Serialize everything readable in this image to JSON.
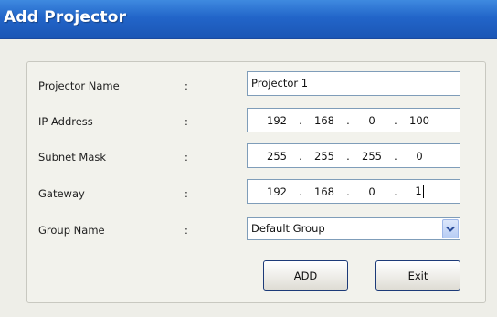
{
  "window": {
    "title": "Add Projector"
  },
  "form": {
    "projector_name": {
      "label": "Projector Name",
      "colon": ":",
      "value": "Projector 1"
    },
    "ip_address": {
      "label": "IP Address",
      "colon": ":",
      "octets": [
        "192",
        "168",
        "0",
        "100"
      ]
    },
    "subnet_mask": {
      "label": "Subnet Mask",
      "colon": ":",
      "octets": [
        "255",
        "255",
        "255",
        "0"
      ]
    },
    "gateway": {
      "label": "Gateway",
      "colon": ":",
      "octets": [
        "192",
        "168",
        "0",
        "1"
      ]
    },
    "group_name": {
      "label": "Group Name",
      "colon": ":",
      "selected": "Default Group"
    },
    "ip_separator": "."
  },
  "buttons": {
    "add": "ADD",
    "exit": "Exit"
  },
  "icons": {
    "dropdown": "chevron-down-icon"
  },
  "colors": {
    "title_bar": "#2265c9",
    "field_border": "#7f9db9",
    "button_border": "#1c3a78"
  }
}
